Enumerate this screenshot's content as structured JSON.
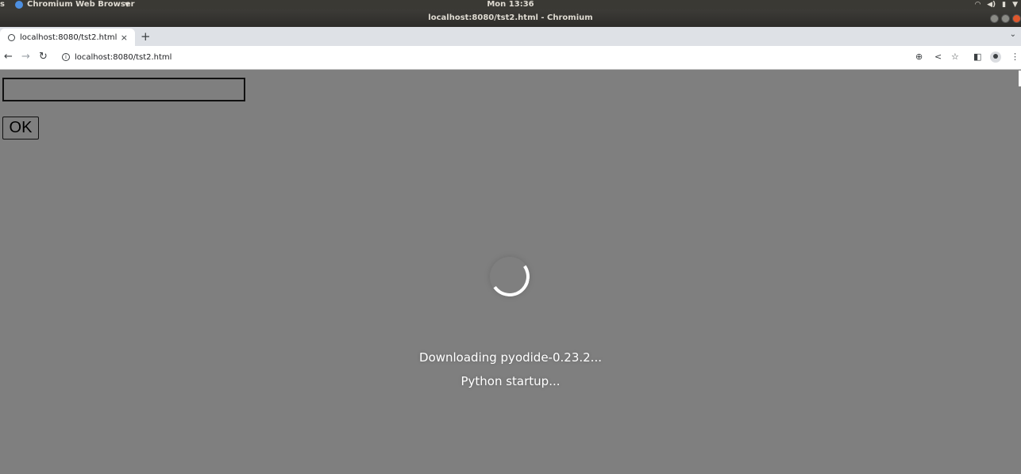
{
  "top_panel": {
    "activities": "s",
    "app_name": "Chromium Web Browser",
    "clock": "Mon 13:36"
  },
  "window": {
    "title": "localhost:8080/tst2.html - Chromium"
  },
  "tabs": [
    {
      "label": "localhost:8080/tst2.html",
      "close": "×"
    }
  ],
  "new_tab_label": "+",
  "toolbar": {
    "back": "←",
    "forward": "→",
    "reload": "↻",
    "url": "localhost:8080/tst2.html",
    "info": "i",
    "zoom": "⊕",
    "share": "<",
    "bookmark": "☆",
    "sidepanel": "◧",
    "menu": "⋮"
  },
  "page": {
    "input_value": "",
    "ok_label": "OK",
    "status_line1": "Downloading pyodide-0.23.2...",
    "status_line2": "Python startup..."
  },
  "colors": {
    "page_background": "#7f7f7f",
    "status_text": "#ffffff"
  }
}
